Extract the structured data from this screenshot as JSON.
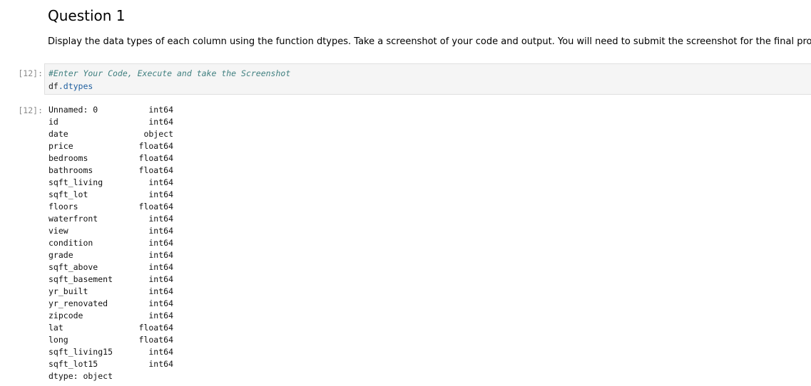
{
  "heading": "Question 1",
  "instructions": "Display the data types of each column using the function dtypes. Take a screenshot of your code and output. You will need to submit the screenshot for the final project.",
  "input_cell": {
    "prompt": "[12]:",
    "comment": "#Enter Your Code, Execute and take the Screenshot",
    "code_object": "df",
    "code_attr": ".dtypes"
  },
  "output_cell": {
    "prompt": "[12]:",
    "rows": [
      {
        "name": "Unnamed: 0",
        "type": "int64"
      },
      {
        "name": "id",
        "type": "int64"
      },
      {
        "name": "date",
        "type": "object"
      },
      {
        "name": "price",
        "type": "float64"
      },
      {
        "name": "bedrooms",
        "type": "float64"
      },
      {
        "name": "bathrooms",
        "type": "float64"
      },
      {
        "name": "sqft_living",
        "type": "int64"
      },
      {
        "name": "sqft_lot",
        "type": "int64"
      },
      {
        "name": "floors",
        "type": "float64"
      },
      {
        "name": "waterfront",
        "type": "int64"
      },
      {
        "name": "view",
        "type": "int64"
      },
      {
        "name": "condition",
        "type": "int64"
      },
      {
        "name": "grade",
        "type": "int64"
      },
      {
        "name": "sqft_above",
        "type": "int64"
      },
      {
        "name": "sqft_basement",
        "type": "int64"
      },
      {
        "name": "yr_built",
        "type": "int64"
      },
      {
        "name": "yr_renovated",
        "type": "int64"
      },
      {
        "name": "zipcode",
        "type": "int64"
      },
      {
        "name": "lat",
        "type": "float64"
      },
      {
        "name": "long",
        "type": "float64"
      },
      {
        "name": "sqft_living15",
        "type": "int64"
      },
      {
        "name": "sqft_lot15",
        "type": "int64"
      }
    ],
    "footer": "dtype: object"
  }
}
